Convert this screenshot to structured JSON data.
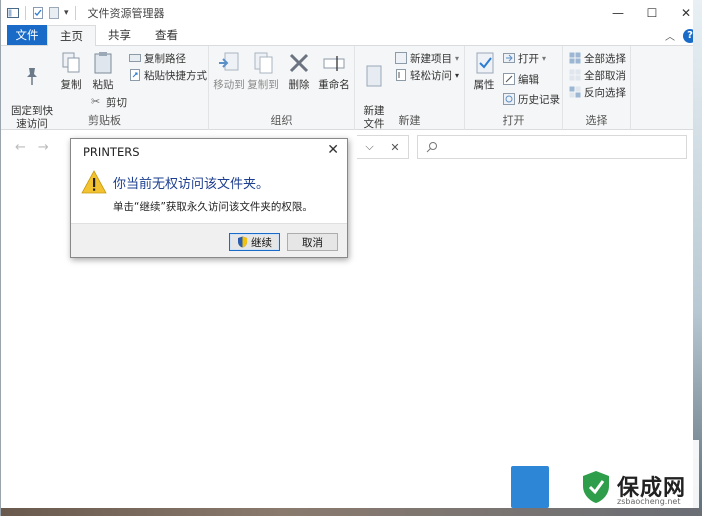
{
  "window": {
    "title": "文件资源管理器",
    "controls": {
      "minimize": "—",
      "maximize": "☐",
      "close": "✕"
    }
  },
  "ribbon_tabs": [
    {
      "label": "文件",
      "active": false
    },
    {
      "label": "主页",
      "active": true
    },
    {
      "label": "共享",
      "active": false
    },
    {
      "label": "查看",
      "active": false
    }
  ],
  "ribbon": {
    "clipboard": {
      "label": "剪贴板",
      "pin": "固定到快\n速访问",
      "copy": "复制",
      "paste": "粘贴",
      "cut": "剪切",
      "copy_path": "复制路径",
      "paste_shortcut": "粘贴快捷方式"
    },
    "organize": {
      "label": "组织",
      "move_to": "移动到",
      "copy_to": "复制到",
      "delete": "删除",
      "rename": "重命名"
    },
    "new": {
      "label": "新建",
      "new_folder": "新建\n文件夹",
      "new_item": "新建项目",
      "easy_access": "轻松访问"
    },
    "open": {
      "label": "打开",
      "properties": "属性",
      "open": "打开",
      "edit": "编辑",
      "history": "历史记录"
    },
    "select": {
      "label": "选择",
      "select_all": "全部选择",
      "select_none": "全部取消",
      "invert": "反向选择"
    }
  },
  "dialog": {
    "title": "PRINTERS",
    "message": "你当前无权访问该文件夹。",
    "detail": "单击“继续”获取永久访问该文件夹的权限。",
    "continue_label": "继续",
    "cancel_label": "取消"
  },
  "watermark": {
    "brand": "保成网",
    "url": "zsbaocheng.net"
  },
  "colors": {
    "accent": "#1a6bc7",
    "dialog_heading": "#1d3f8f",
    "warning": "#f2c231"
  }
}
